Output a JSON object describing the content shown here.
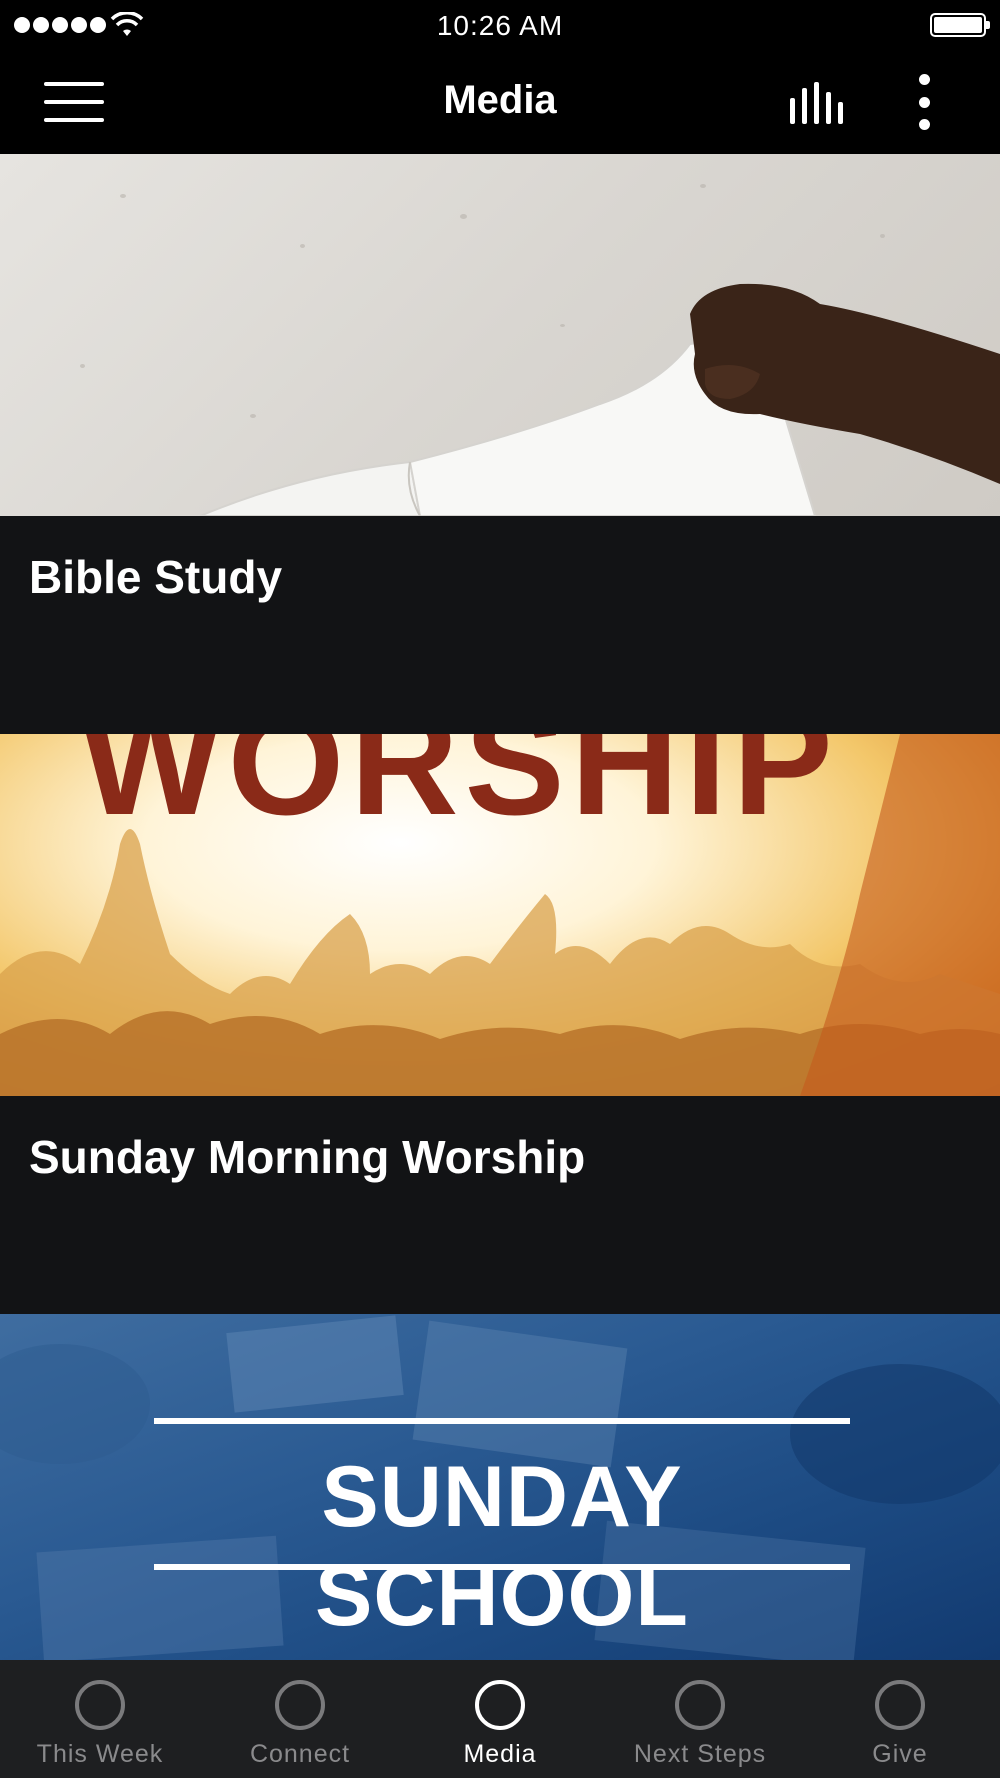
{
  "status_bar": {
    "time": "10:26 AM"
  },
  "nav": {
    "title": "Media"
  },
  "cards": [
    {
      "title": "Bible Study"
    },
    {
      "title": "Sunday Morning Worship"
    },
    {
      "title": "",
      "banner_text": "SUNDAY SCHOOL"
    }
  ],
  "worship_banner_text": "WORSHIP",
  "tabs": [
    {
      "label": "This Week",
      "active": false
    },
    {
      "label": "Connect",
      "active": false
    },
    {
      "label": "Media",
      "active": true
    },
    {
      "label": "Next Steps",
      "active": false
    },
    {
      "label": "Give",
      "active": false
    }
  ],
  "colors": {
    "background": "#000000",
    "card_background": "#121315",
    "tab_bar": "#1e1f21",
    "tab_inactive": "#8a8a8c",
    "tab_active": "#ffffff"
  },
  "icons": [
    "signal-icon",
    "wifi-icon",
    "battery-icon",
    "hamburger-menu-icon",
    "audio-bars-icon",
    "more-vertical-icon",
    "tab-circle-icon"
  ]
}
